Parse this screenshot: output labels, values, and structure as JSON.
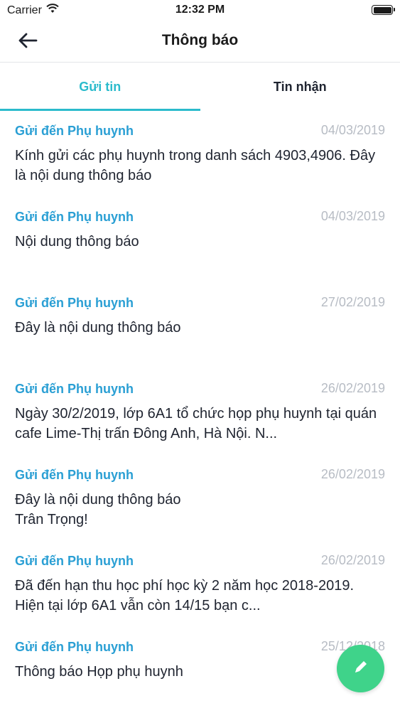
{
  "status_bar": {
    "carrier": "Carrier",
    "time": "12:32 PM"
  },
  "nav": {
    "title": "Thông báo"
  },
  "tabs": [
    {
      "label": "Gửi tin",
      "active": true
    },
    {
      "label": "Tin nhận",
      "active": false
    }
  ],
  "messages": [
    {
      "recipient": "Gửi đến Phụ huynh",
      "date": "04/03/2019",
      "body": "Kính gửi các phụ huynh trong danh sách 4903,4906. Đây là nội dung thông báo"
    },
    {
      "recipient": "Gửi đến Phụ huynh",
      "date": "04/03/2019",
      "body": "Nội dung thông báo"
    },
    {
      "recipient": "Gửi đến Phụ huynh",
      "date": "27/02/2019",
      "body": "Đây là nội dung thông báo"
    },
    {
      "recipient": "Gửi đến Phụ huynh",
      "date": "26/02/2019",
      "body": "Ngày 30/2/2019, lớp 6A1 tổ chức họp phụ huynh tại quán cafe Lime-Thị trấn Đông Anh, Hà Nội. N..."
    },
    {
      "recipient": "Gửi đến Phụ huynh",
      "date": "26/02/2019",
      "body": "Đây là nội dung thông báo\nTrân Trọng!"
    },
    {
      "recipient": "Gửi đến Phụ huynh",
      "date": "26/02/2019",
      "body": "Đã đến hạn thu học phí học kỳ 2 năm học 2018-2019. Hiện tại lớp 6A1 vẫn còn 14/15 bạn c..."
    },
    {
      "recipient": "Gửi đến Phụ huynh",
      "date": "25/12/2018",
      "body": "Thông báo Họp phụ huynh"
    }
  ],
  "icons": {
    "back": "arrow-left-icon",
    "compose": "pencil-icon",
    "wifi": "wifi-icon",
    "battery": "battery-icon"
  },
  "colors": {
    "accent": "#2bbbcc",
    "recipient": "#2a9fd4",
    "fab": "#3fd38a",
    "date": "#b7bcc4"
  }
}
